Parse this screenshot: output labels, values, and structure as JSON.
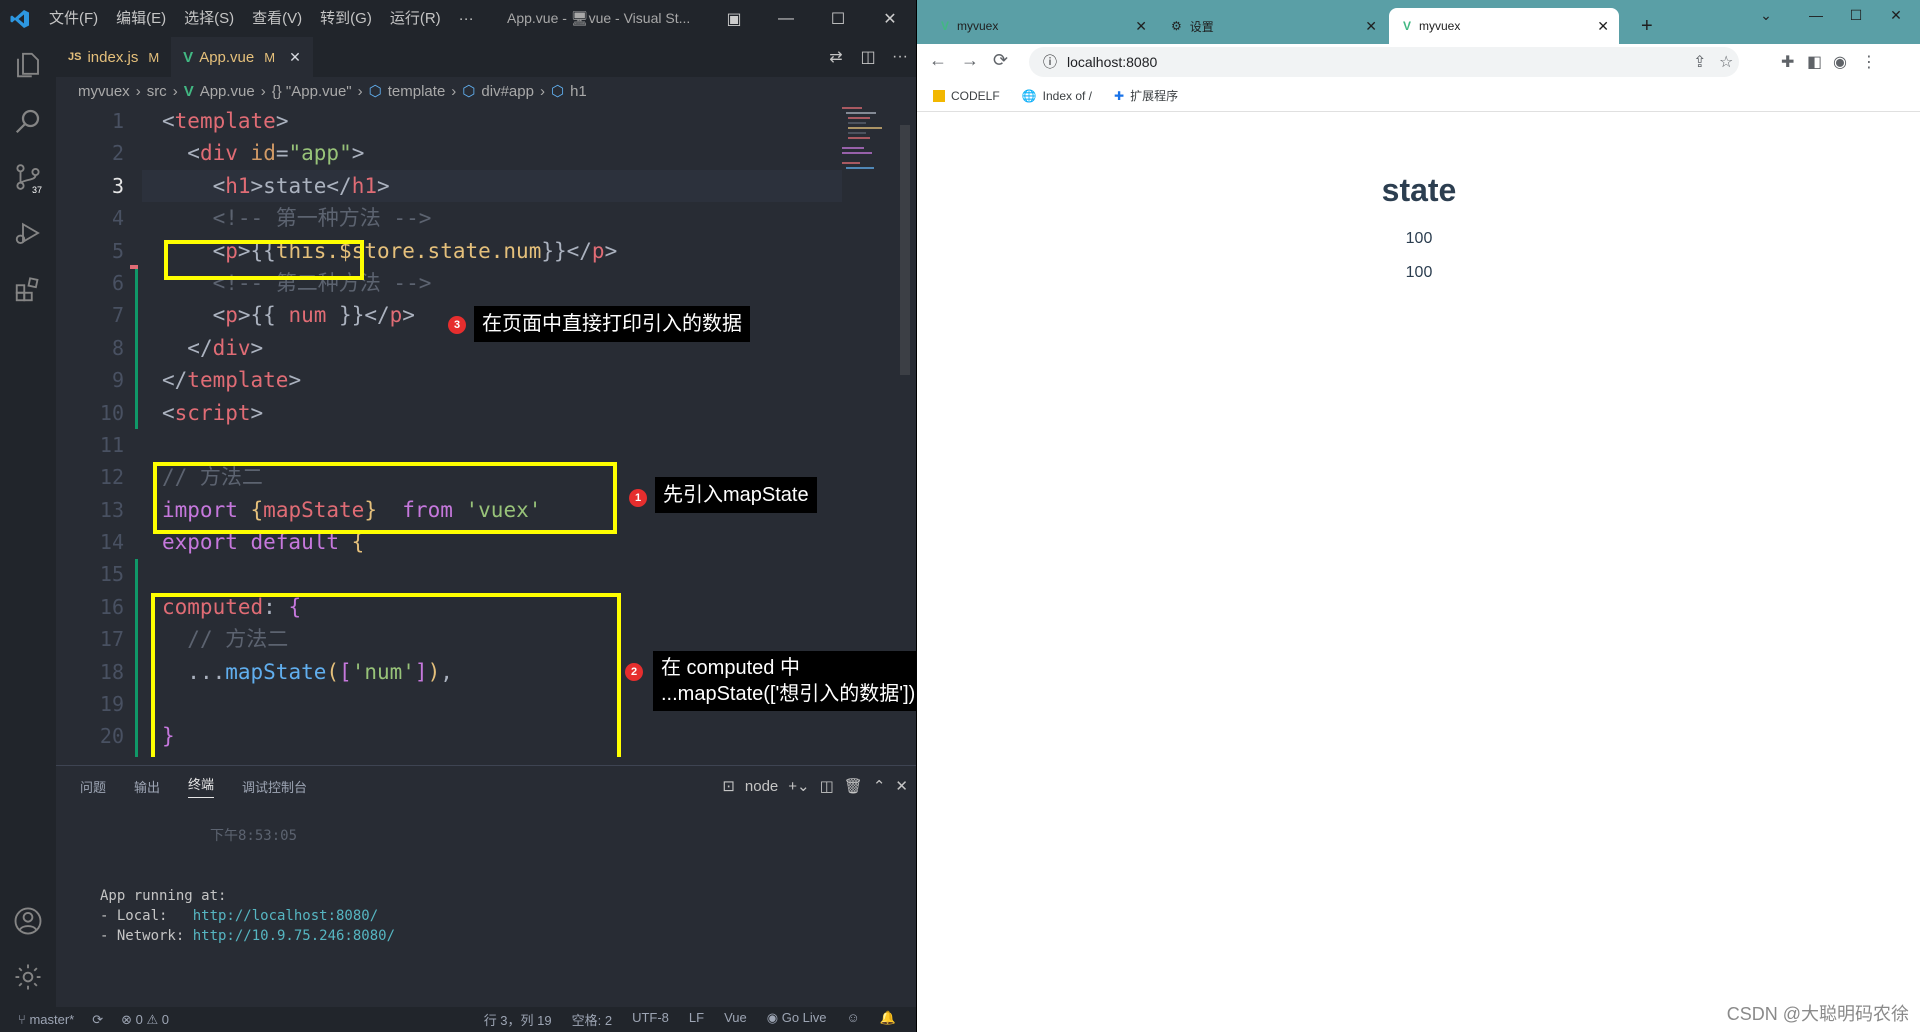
{
  "vscode": {
    "menu": [
      "文件(F)",
      "编辑(E)",
      "选择(S)",
      "查看(V)",
      "转到(G)",
      "运行(R)",
      "···"
    ],
    "window_title": "App.vue - 🖥vue - Visual St...",
    "tabs": [
      {
        "label": "index.js",
        "prefix": "JS",
        "status": "M"
      },
      {
        "label": "App.vue",
        "prefix": "V",
        "status": "M"
      }
    ],
    "breadcrumb": [
      "myvuex",
      "src",
      "App.vue",
      "{} \"App.vue\"",
      "template",
      "div#app",
      "h1"
    ],
    "activity_badge": "37",
    "line_numbers": [
      "1",
      "2",
      "3",
      "4",
      "5",
      "6",
      "7",
      "8",
      "9",
      "10",
      "11",
      "12",
      "13",
      "14",
      "15",
      "16",
      "17",
      "18",
      "19",
      "20"
    ],
    "annotations": {
      "a1": {
        "badge": "1",
        "text": "先引入mapState"
      },
      "a2": {
        "badge": "2",
        "line1": "在 computed  中",
        "line2": "...mapState(['想引入的数据'])"
      },
      "a3": {
        "badge": "3",
        "text": "在页面中直接打印引入的数据"
      }
    },
    "panel": {
      "tabs": [
        "问题",
        "输出",
        "终端",
        "调试控制台"
      ],
      "active_tab": "终端",
      "terminal_name": "node",
      "time": "下午8:53:05",
      "running": "App running at:",
      "local_label": "- Local:   ",
      "local_url": "http://localhost:8080/",
      "network_label": "- Network: ",
      "network_url": "http://10.9.75.246:8080/"
    },
    "status": {
      "branch": "master*",
      "problems": "⊗ 0 ⚠ 0",
      "position": "行 3，列 19",
      "spaces": "空格: 2",
      "encoding": "UTF-8",
      "eol": "LF",
      "language": "Vue",
      "golive": "Go Live"
    }
  },
  "chrome": {
    "tabs": [
      {
        "label": "myvuex"
      },
      {
        "label": "设置"
      },
      {
        "label": "myvuex"
      }
    ],
    "url": "localhost:8080",
    "bookmarks": [
      "CODELF",
      "Index of /",
      "扩展程序"
    ],
    "page": {
      "title": "state",
      "values": [
        "100",
        "100"
      ]
    },
    "watermark": "CSDN @大聪明码农徐"
  }
}
